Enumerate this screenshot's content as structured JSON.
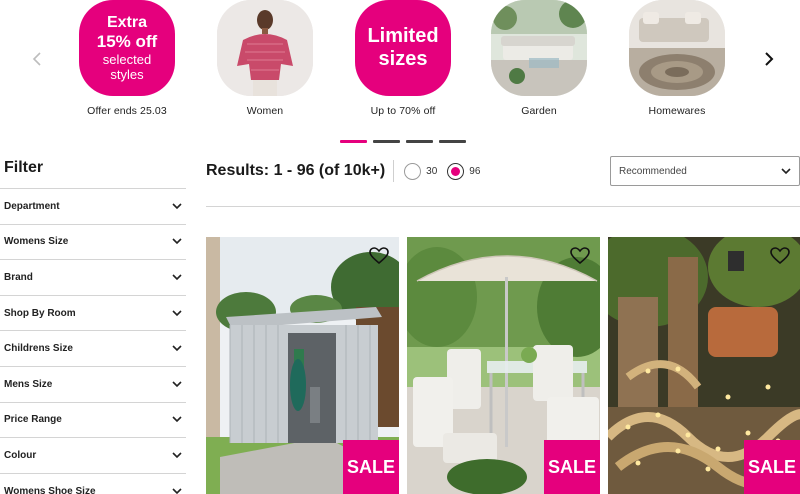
{
  "carousel": {
    "prev_icon": "chevron-left-icon",
    "next_icon": "chevron-right-icon",
    "tiles": [
      {
        "type": "promo",
        "line1": "Extra",
        "line2": "15% off",
        "line3": "selected",
        "line4": "styles",
        "caption": "Offer ends 25.03"
      },
      {
        "type": "photo",
        "caption": "Women"
      },
      {
        "type": "promo",
        "line1": "Limited",
        "line2": "sizes",
        "caption": "Up to 70% off"
      },
      {
        "type": "photo",
        "caption": "Garden"
      },
      {
        "type": "photo",
        "caption": "Homewares"
      }
    ],
    "dots": 4,
    "active_dot": 0
  },
  "filter": {
    "title": "Filter",
    "facets": [
      {
        "label": "Department"
      },
      {
        "label": "Womens Size"
      },
      {
        "label": "Brand"
      },
      {
        "label": "Shop By Room"
      },
      {
        "label": "Childrens Size"
      },
      {
        "label": "Mens Size"
      },
      {
        "label": "Price Range"
      },
      {
        "label": "Colour"
      },
      {
        "label": "Womens Shoe Size"
      }
    ]
  },
  "results": {
    "text": "Results: 1 - 96 (of 10k+)",
    "per_page_options": [
      "30",
      "96"
    ],
    "per_page_selected": "96"
  },
  "sort": {
    "value": "Recommended"
  },
  "products": [
    {
      "badge": "SALE",
      "wishlist_icon": "heart-outline-icon"
    },
    {
      "badge": "SALE",
      "wishlist_icon": "heart-outline-icon"
    },
    {
      "badge": "SALE",
      "wishlist_icon": "heart-outline-icon"
    }
  ],
  "colors": {
    "accent": "#e5007d",
    "text": "#1a1a1a",
    "divider": "#d4d4d4"
  }
}
